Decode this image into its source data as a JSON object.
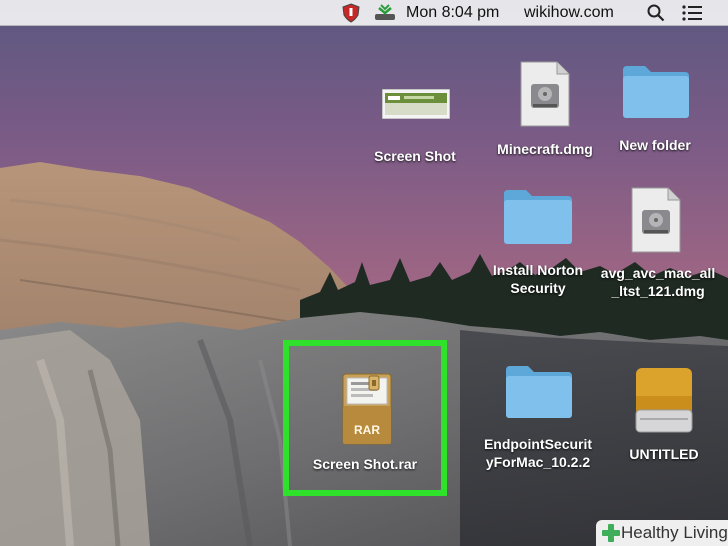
{
  "menubar": {
    "datetime": "Mon 8:04 pm",
    "username": "wikihow.com",
    "icons": [
      "norton-shield-icon",
      "network-status-icon",
      "spotlight-search-icon",
      "notification-list-icon"
    ]
  },
  "desktop_items": {
    "screen_shot_png": {
      "label": "Screen Shot",
      "icon": "screenshot-thumbnail-icon"
    },
    "minecraft_dmg": {
      "label": "Minecraft.dmg",
      "icon": "disk-image-icon"
    },
    "new_folder": {
      "label": "New folder",
      "icon": "folder-icon"
    },
    "install_norton": {
      "label_line1": "Install Norton",
      "label_line2": "Security",
      "icon": "folder-icon"
    },
    "avg_dmg": {
      "label_line1": "avg_avc_mac_all",
      "label_line2": "_ltst_121.dmg",
      "icon": "disk-image-icon"
    },
    "screen_shot_rar": {
      "label": "Screen Shot.rar",
      "icon": "rar-archive-icon",
      "badge": "RAR",
      "highlighted": true
    },
    "endpoint_security": {
      "label_line1": "EndpointSecurit",
      "label_line2": "yForMac_10.2.2",
      "icon": "folder-icon"
    },
    "untitled_drive": {
      "label": "UNTITLED",
      "icon": "external-drive-icon"
    }
  },
  "watermark": {
    "text": "Healthy Living"
  },
  "colors": {
    "highlight": "#2fe12b",
    "folder_body": "#7fc0ec",
    "folder_tab": "#5ea7d9",
    "menubar_bg": "#ececee",
    "drive_top": "#dba22c"
  }
}
